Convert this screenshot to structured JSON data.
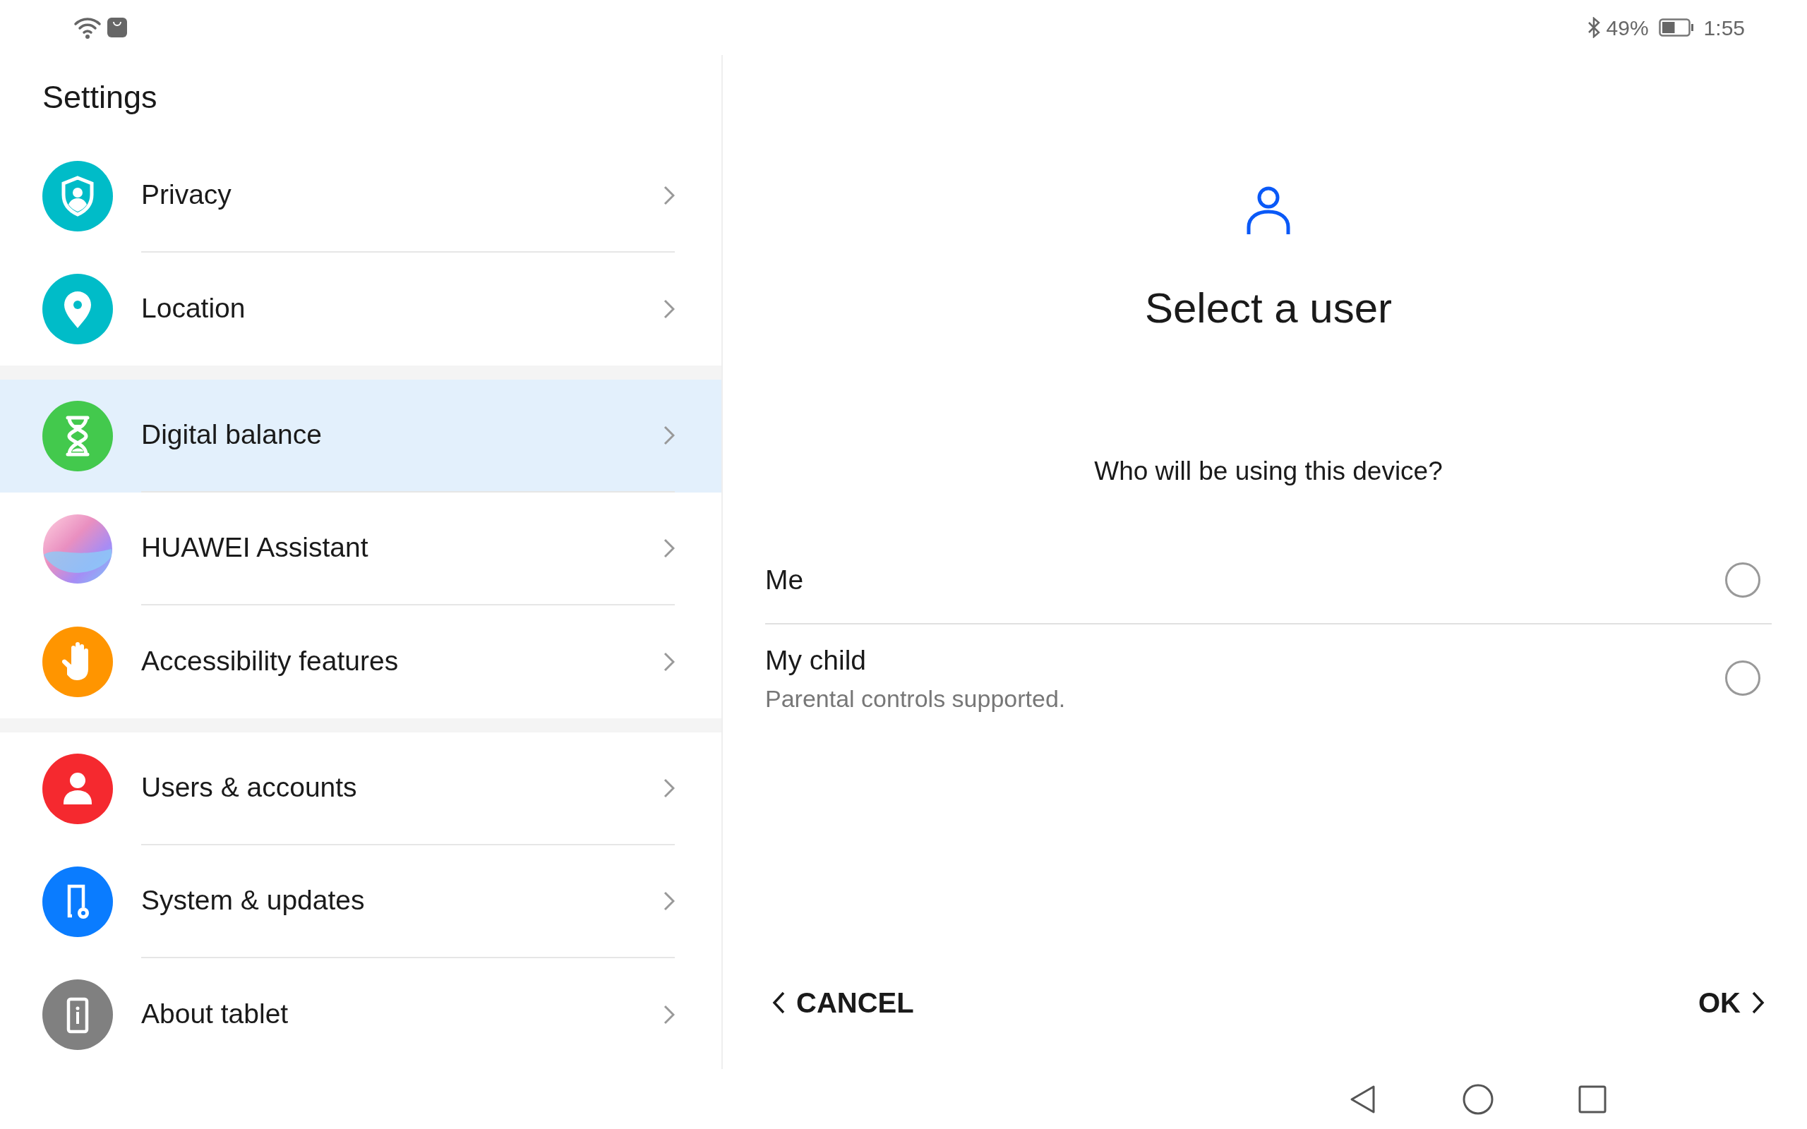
{
  "status_bar": {
    "battery_percent": "49%",
    "time": "1:55"
  },
  "settings": {
    "title": "Settings",
    "groups": [
      {
        "items": [
          {
            "label": "Privacy",
            "kind": "shield",
            "color": "#00bcc8",
            "selected": false
          },
          {
            "label": "Location",
            "kind": "pin",
            "color": "#00bcc8",
            "selected": false
          }
        ]
      },
      {
        "items": [
          {
            "label": "Digital balance",
            "kind": "hourglass",
            "color": "#43c94d",
            "selected": true
          },
          {
            "label": "HUAWEI Assistant",
            "kind": "assistant",
            "selected": false
          },
          {
            "label": "Accessibility features",
            "kind": "hand",
            "color": "#ff9500",
            "selected": false
          }
        ]
      },
      {
        "items": [
          {
            "label": "Users & accounts",
            "kind": "person",
            "color": "#f5292f",
            "selected": false
          },
          {
            "label": "System & updates",
            "kind": "device-gear",
            "color": "#0a7cff",
            "selected": false
          },
          {
            "label": "About tablet",
            "kind": "device-info",
            "color": "#808080",
            "selected": false
          }
        ]
      }
    ]
  },
  "dialog": {
    "title": "Select a user",
    "question": "Who will be using this device?",
    "options": [
      {
        "label": "Me",
        "selected": false
      },
      {
        "label": "My child",
        "sublabel": "Parental controls supported.",
        "selected": false
      }
    ],
    "buttons": [
      {
        "label": "CANCEL",
        "kind": "back"
      },
      {
        "label": "OK",
        "kind": "next"
      }
    ]
  }
}
